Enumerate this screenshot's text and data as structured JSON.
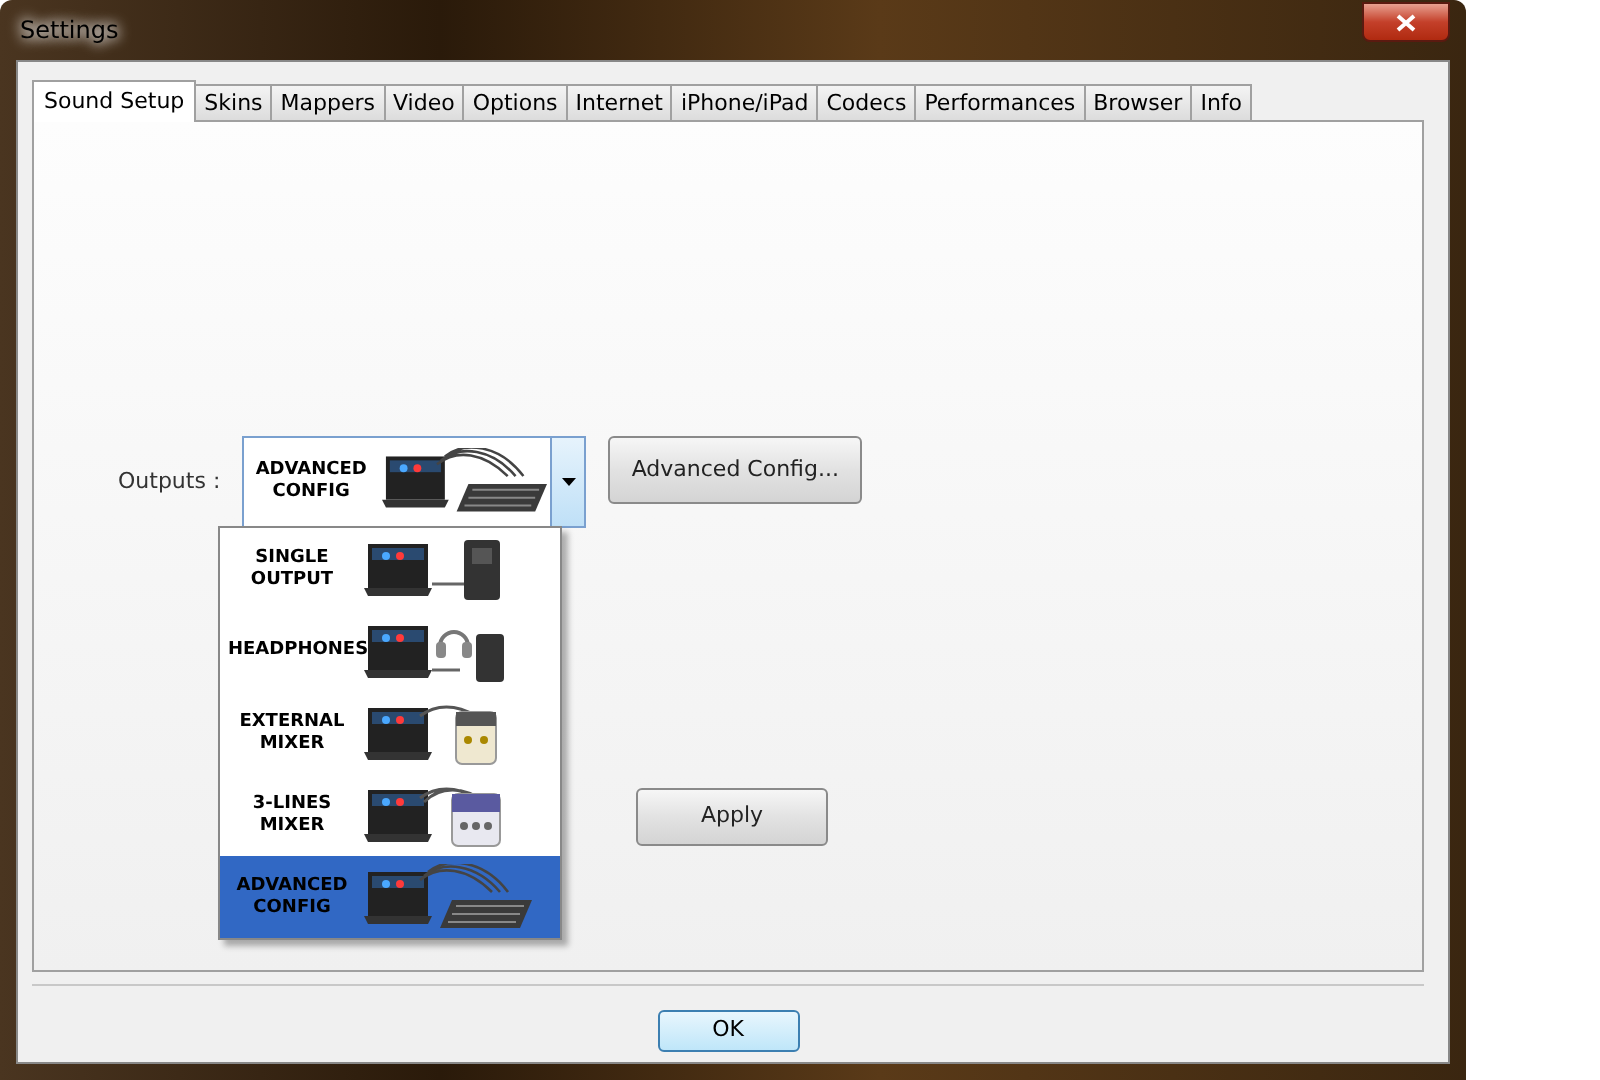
{
  "window": {
    "title": "Settings"
  },
  "tabs": [
    {
      "label": "Sound Setup",
      "selected": true
    },
    {
      "label": "Skins",
      "selected": false
    },
    {
      "label": "Mappers",
      "selected": false
    },
    {
      "label": "Video",
      "selected": false
    },
    {
      "label": "Options",
      "selected": false
    },
    {
      "label": "Internet",
      "selected": false
    },
    {
      "label": "iPhone/iPad",
      "selected": false
    },
    {
      "label": "Codecs",
      "selected": false
    },
    {
      "label": "Performances",
      "selected": false
    },
    {
      "label": "Browser",
      "selected": false
    },
    {
      "label": "Info",
      "selected": false
    }
  ],
  "outputs": {
    "label": "Outputs :",
    "value": {
      "text": "ADVANCED CONFIG",
      "kind": "console"
    },
    "expanded": true,
    "options": [
      {
        "text": "SINGLE OUTPUT",
        "kind": "speaker",
        "selected": false
      },
      {
        "text": "HEADPHONES",
        "kind": "headphones",
        "selected": false
      },
      {
        "text": "EXTERNAL MIXER",
        "kind": "mixer",
        "selected": false
      },
      {
        "text": "3-LINES MIXER",
        "kind": "lines",
        "selected": false
      },
      {
        "text": "ADVANCED CONFIG",
        "kind": "console",
        "selected": true
      }
    ]
  },
  "advanced_button": "Advanced Config...",
  "apply_button": "Apply",
  "ok_button": "OK"
}
